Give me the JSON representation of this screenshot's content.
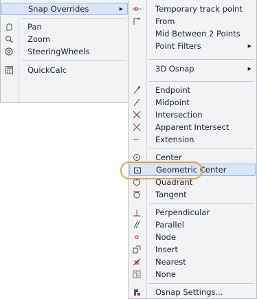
{
  "context_menu": {
    "items": [
      {
        "label": "Snap Overrides",
        "icon": "none",
        "submenu": true
      },
      {
        "label": "Pan",
        "icon": "pan-icon"
      },
      {
        "label": "Zoom",
        "icon": "zoom-icon"
      },
      {
        "label": "SteeringWheels",
        "icon": "steeringwheels-icon"
      },
      {
        "label": "QuickCalc",
        "icon": "quickcalc-icon"
      }
    ]
  },
  "snap_submenu": {
    "items": [
      {
        "label": "Temporary track point",
        "icon": "temporary-track-point-icon"
      },
      {
        "label": "From",
        "icon": "from-icon"
      },
      {
        "label": "Mid Between 2 Points",
        "icon": "none"
      },
      {
        "label": "Point Filters",
        "icon": "none",
        "submenu": true
      },
      {
        "label": "3D Osnap",
        "icon": "none",
        "submenu": true
      },
      {
        "label": "Endpoint",
        "icon": "endpoint-icon"
      },
      {
        "label": "Midpoint",
        "icon": "midpoint-icon"
      },
      {
        "label": "Intersection",
        "icon": "intersection-icon"
      },
      {
        "label": "Apparent Intersect",
        "icon": "apparent-intersect-icon"
      },
      {
        "label": "Extension",
        "icon": "extension-icon"
      },
      {
        "label": "Center",
        "icon": "center-icon"
      },
      {
        "label": "Geometric Center",
        "icon": "geometric-center-icon",
        "highlighted": true
      },
      {
        "label": "Quadrant",
        "icon": "quadrant-icon"
      },
      {
        "label": "Tangent",
        "icon": "tangent-icon"
      },
      {
        "label": "Perpendicular",
        "icon": "perpendicular-icon"
      },
      {
        "label": "Parallel",
        "icon": "parallel-icon"
      },
      {
        "label": "Node",
        "icon": "node-icon"
      },
      {
        "label": "Insert",
        "icon": "insert-icon"
      },
      {
        "label": "Nearest",
        "icon": "nearest-icon"
      },
      {
        "label": "None",
        "icon": "none-osnap-icon"
      },
      {
        "label": "Osnap Settings...",
        "icon": "osnap-settings-icon"
      }
    ]
  },
  "colors": {
    "menu_bg": "#f2f3f5",
    "highlight_bg": "#d9e6f7",
    "callout": "#e3a43d",
    "snap_icon_red": "#c8312b"
  }
}
